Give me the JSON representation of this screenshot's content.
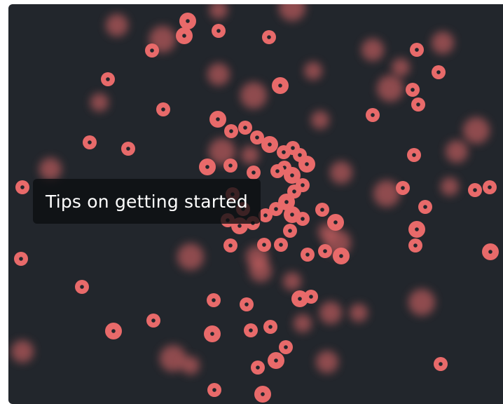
{
  "card": {
    "title": "Tips on getting started"
  },
  "colors": {
    "background": "#22262c",
    "dot": "#e86a6a",
    "dot_center": "#22262c",
    "label_background": "#0c0e11",
    "label_text": "#ffffff"
  }
}
